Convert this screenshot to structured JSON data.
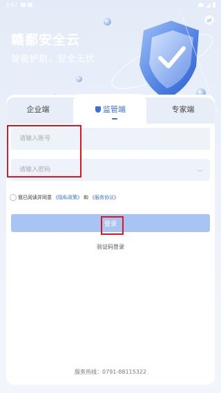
{
  "status_bar": {
    "time": "3:57"
  },
  "hero": {
    "title": "赣鄱安全云",
    "subtitle": "智能护航，安全无忧"
  },
  "tabs": [
    {
      "label": "企业端",
      "active": false
    },
    {
      "label": "监管端",
      "active": true
    },
    {
      "label": "专家端",
      "active": false
    }
  ],
  "form": {
    "account_placeholder": "请输入账号",
    "password_placeholder": "请输入密码",
    "agree_prefix": "我已阅读并同意",
    "privacy_link": "《隐私政策》",
    "and": "和",
    "service_link": "《服务协议》",
    "login_label": "登录",
    "code_login_label": "验证码登录"
  },
  "footer": {
    "hotline": "服务热线：0791-88115322"
  },
  "colors": {
    "accent": "#3a6fd8",
    "login_button": "#a9c4f3",
    "highlight": "#e0141e"
  }
}
